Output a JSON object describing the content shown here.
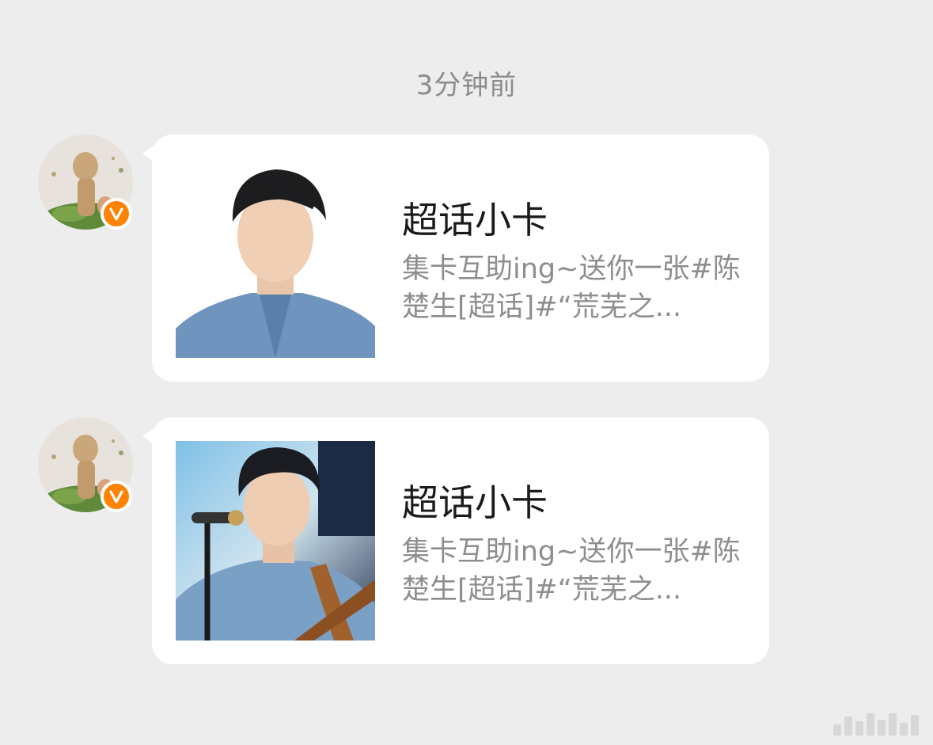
{
  "timestamp": "3分钟前",
  "messages": [
    {
      "avatar_icon": "verified-user-avatar",
      "badge_letter": "V",
      "badge_color": "#ff8200",
      "card": {
        "title": "超话小卡",
        "description": "集卡互助ing~送你一张#陈楚生[超话]#“荒芜之..."
      }
    },
    {
      "avatar_icon": "verified-user-avatar",
      "badge_letter": "V",
      "badge_color": "#ff8200",
      "card": {
        "title": "超话小卡",
        "description": "集卡互助ing~送你一张#陈楚生[超话]#“荒芜之..."
      }
    }
  ]
}
